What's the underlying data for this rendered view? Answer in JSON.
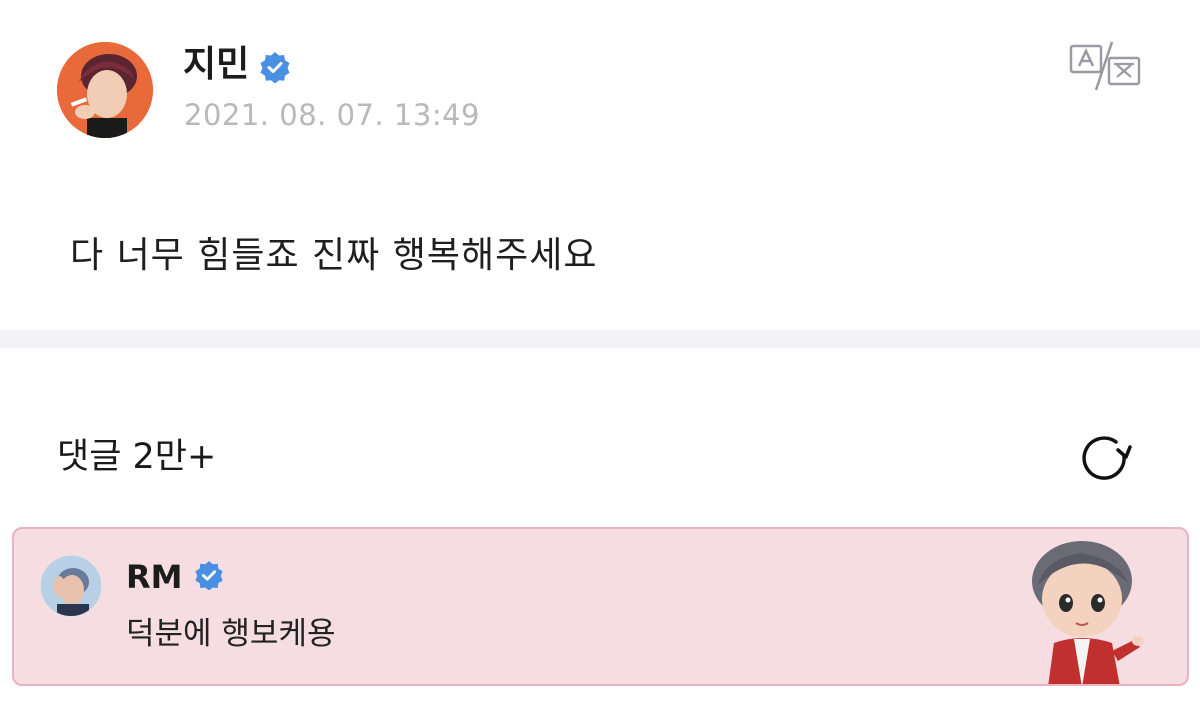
{
  "post": {
    "author_name": "지민",
    "timestamp": "2021. 08. 07. 13:49",
    "text": "다 너무 힘들죠 진짜 행복해주세요"
  },
  "comments": {
    "title": "댓글 2만+",
    "pinned": {
      "author_name": "RM",
      "text": "덕분에 행보케용"
    }
  },
  "icons": {
    "verified": "verified-badge-icon",
    "translate": "translate-icon",
    "refresh": "refresh-icon"
  },
  "colors": {
    "verified_blue": "#4a90e2",
    "timestamp_gray": "#b8b8bd",
    "card_background": "#f6dde2",
    "card_border": "#eab3bf",
    "divider": "#f4f4f7",
    "avatar_bg": "#e8693a"
  }
}
